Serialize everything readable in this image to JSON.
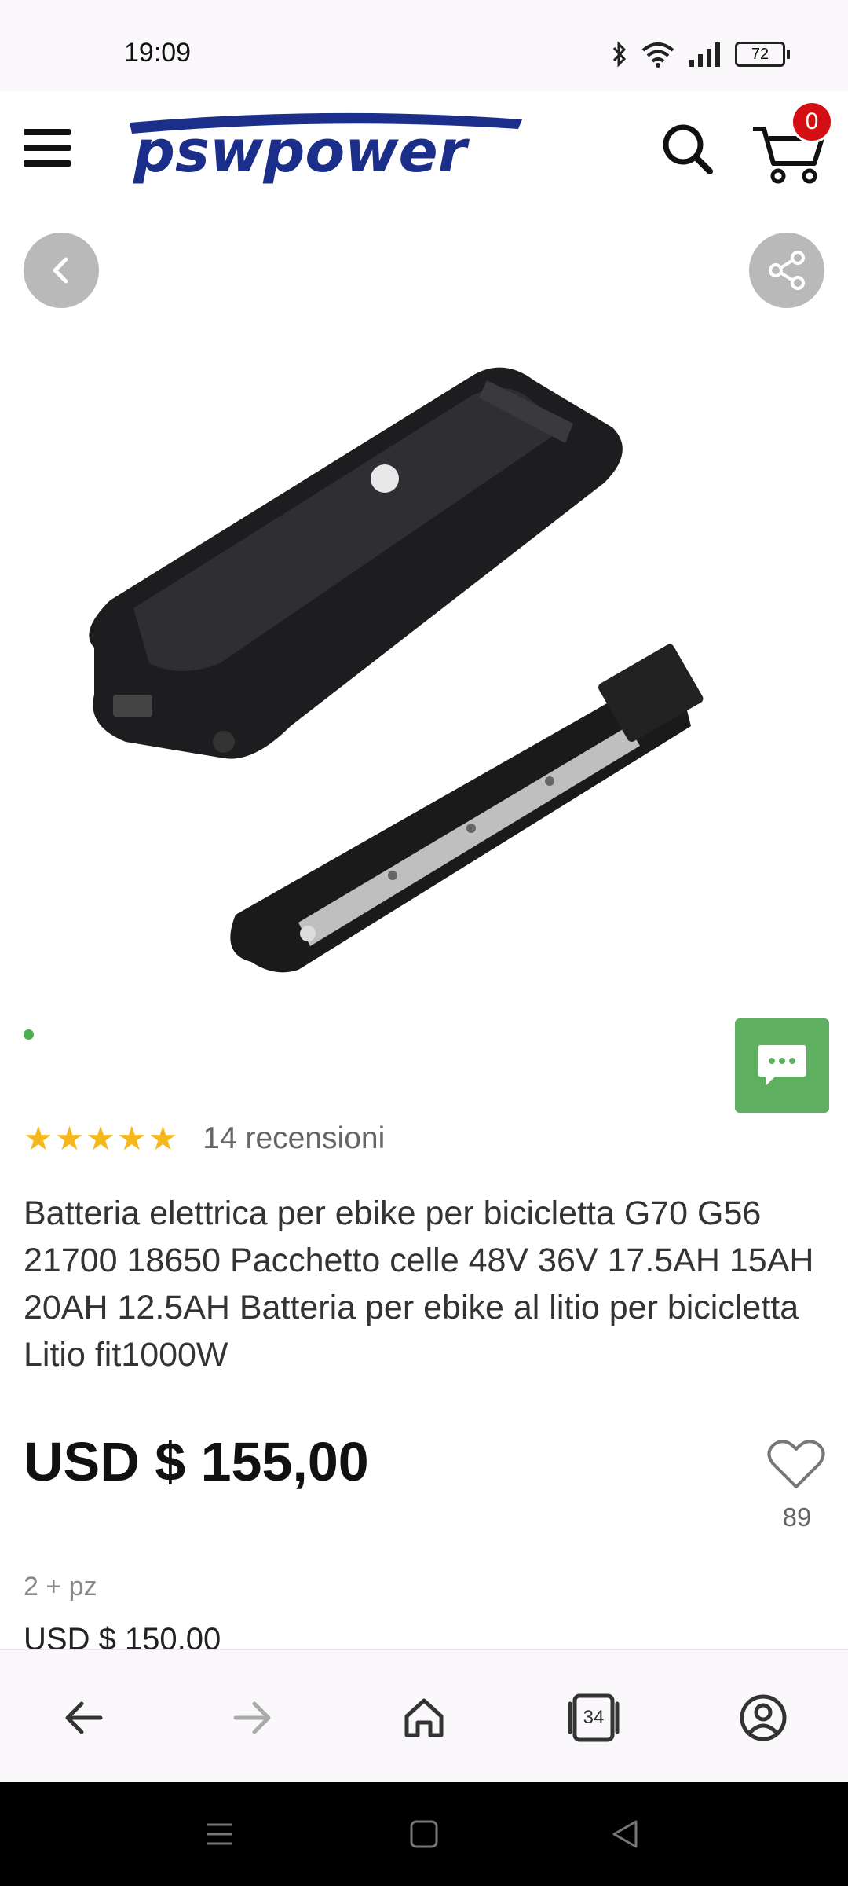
{
  "status": {
    "time": "19:09",
    "battery": "72",
    "icons": [
      "bluetooth-icon",
      "wifi-icon",
      "signal-icon",
      "battery-icon"
    ]
  },
  "header": {
    "logo_text": "pswpower",
    "cart_count": "0",
    "icons": [
      "menu-icon",
      "search-icon",
      "cart-icon"
    ]
  },
  "product": {
    "rating_stars": 5,
    "reviews_label": "14 recensioni",
    "title": "Batteria elettrica per ebike per bicicletta G70 G56 21700 18650 Pacchetto celle 48V 36V 17.5AH 15AH 20AH 12.5AH Batteria per ebike al litio per bicicletta Litio fit1000W",
    "price": "USD $ 155,00",
    "wishlist_count": "89",
    "tier_qty": "2 + pz",
    "tier_price": "USD $ 150,00"
  },
  "toolbar": {
    "tabs_count": "34",
    "icons": [
      "back-arrow-icon",
      "forward-arrow-icon",
      "home-icon",
      "tabs-icon",
      "account-icon"
    ]
  },
  "colors": {
    "accent_green": "#5eaf60",
    "star": "#f5b71b",
    "badge_red": "#d30f13",
    "logo_blue": "#1b2f8a"
  }
}
